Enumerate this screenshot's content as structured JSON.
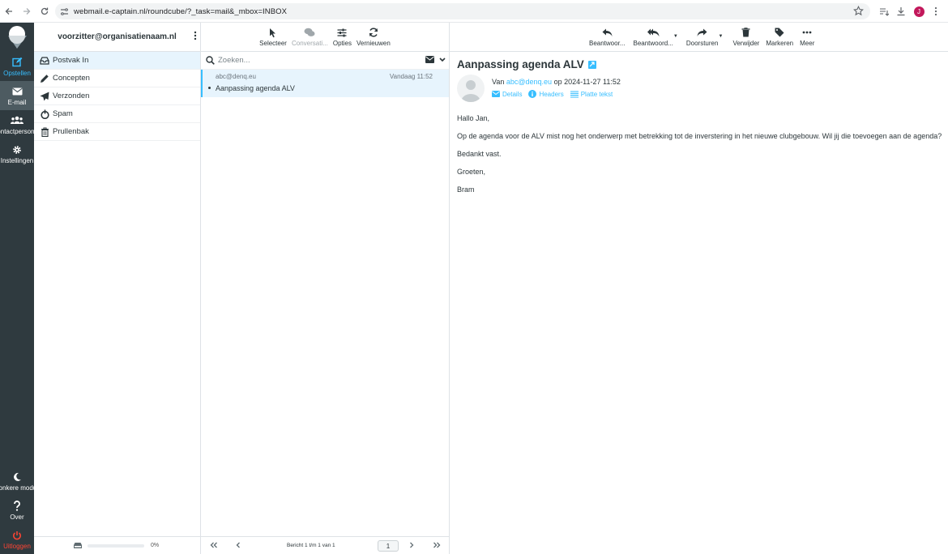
{
  "browser": {
    "url": "webmail.e-captain.nl/roundcube/?_task=mail&_mbox=INBOX",
    "profile_initial": "J"
  },
  "taskmenu": {
    "items": [
      {
        "label": "Opstellen",
        "icon": "compose-icon"
      },
      {
        "label": "E-mail",
        "icon": "envelope-icon"
      },
      {
        "label": "Contactpersonen",
        "icon": "users-icon"
      },
      {
        "label": "Instellingen",
        "icon": "gear-icon"
      }
    ],
    "bottom": [
      {
        "label": "Donkere modus",
        "icon": "moon-icon"
      },
      {
        "label": "Over",
        "icon": "question-icon"
      },
      {
        "label": "Uitloggen",
        "icon": "power-icon"
      }
    ]
  },
  "account": {
    "email": "voorzitter@organisatienaam.nl"
  },
  "folders": [
    {
      "label": "Postvak In",
      "icon": "inbox-icon"
    },
    {
      "label": "Concepten",
      "icon": "pencil-icon"
    },
    {
      "label": "Verzonden",
      "icon": "paper-plane-icon"
    },
    {
      "label": "Spam",
      "icon": "spam-icon"
    },
    {
      "label": "Prullenbak",
      "icon": "trash-icon"
    }
  ],
  "quota": {
    "text": "0%",
    "fraction": 0
  },
  "list_toolbar": {
    "select": "Selecteer",
    "threads": "Conversati...",
    "options": "Opties",
    "refresh": "Vernieuwen"
  },
  "search": {
    "placeholder": "Zoeken..."
  },
  "messages": [
    {
      "from": "abc@denq.eu",
      "date": "Vandaag 11:52",
      "subject": "Aanpassing agenda ALV"
    }
  ],
  "pagination": {
    "count": "Bericht 1 t/m 1 van 1",
    "page": "1"
  },
  "reader_toolbar": {
    "reply": "Beantwoor...",
    "reply_all": "Beantwoord...",
    "forward": "Doorsturen",
    "delete": "Verwijder",
    "mark": "Markeren",
    "more": "Meer"
  },
  "message": {
    "subject": "Aanpassing agenda ALV",
    "from_prefix": "Van",
    "from": "abc@denq.eu",
    "date_prefix": "op",
    "date": "2024-11-27 11:52",
    "links": {
      "details": "Details",
      "headers": "Headers",
      "plain": "Platte tekst"
    },
    "body": [
      "Hallo Jan,",
      "Op de agenda voor de ALV mist nog het onderwerp met betrekking tot de inverstering in het nieuwe clubgebouw. Wil jij die toevoegen aan de agenda?",
      "Bedankt vast.",
      "Groeten,",
      "Bram"
    ]
  },
  "colors": {
    "accent": "#37beff",
    "sidebar": "#2f3a3f",
    "selected": "#e7f4fd",
    "logout": "#ff4433"
  }
}
